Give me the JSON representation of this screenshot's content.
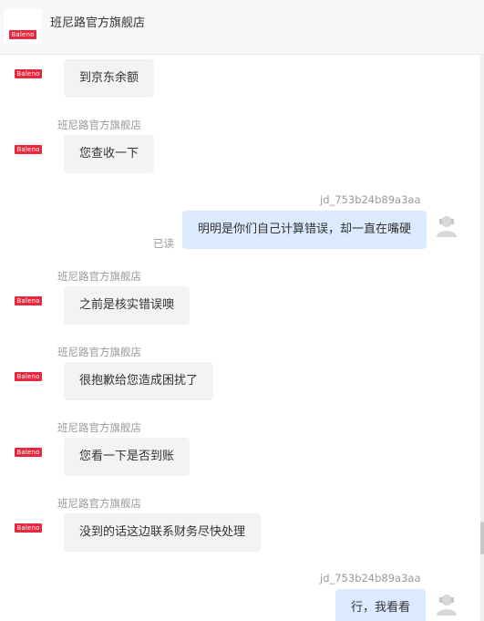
{
  "header": {
    "shop_name": "班尼路官方旗舰店",
    "logo_text": "Baleno"
  },
  "messages": [
    {
      "sender": "",
      "text": "到京东余额",
      "direction": "in"
    },
    {
      "sender": "班尼路官方旗舰店",
      "text": "您查收一下",
      "direction": "in"
    },
    {
      "sender": "jd_753b24b89a3aa",
      "text": "明明是你们自己计算错误，却一直在嘴硬",
      "direction": "out",
      "status": "已读"
    },
    {
      "sender": "班尼路官方旗舰店",
      "text": "之前是核实错误噢",
      "direction": "in"
    },
    {
      "sender": "班尼路官方旗舰店",
      "text": "很抱歉给您造成困扰了",
      "direction": "in"
    },
    {
      "sender": "班尼路官方旗舰店",
      "text": "您看一下是否到账",
      "direction": "in"
    },
    {
      "sender": "班尼路官方旗舰店",
      "text": "没到的话这边联系财务尽快处理",
      "direction": "in"
    },
    {
      "sender": "jd_753b24b89a3aa",
      "text": "行，我看看",
      "direction": "out"
    }
  ],
  "colors": {
    "brand": "#e8283c",
    "in_bubble": "#f3f3f3",
    "out_bubble": "#dbeaff"
  },
  "icons": {
    "shop_avatar": "baleno-logo",
    "user_avatar": "person-icon"
  }
}
